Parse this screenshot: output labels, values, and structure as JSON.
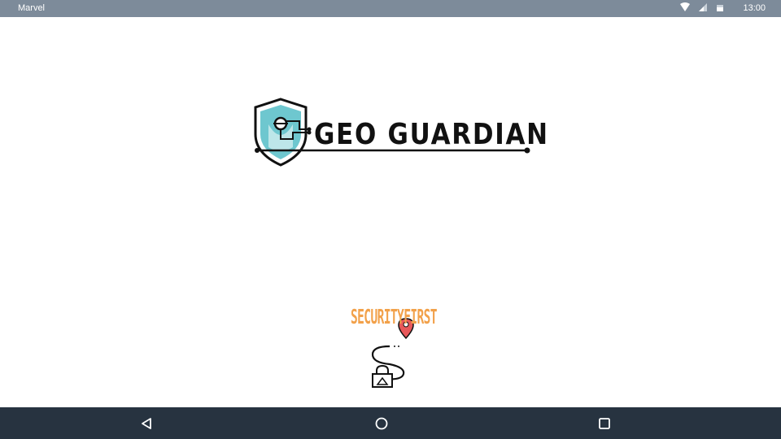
{
  "status_bar": {
    "carrier": "Marvel",
    "time": "13:00",
    "icons": [
      "wifi-icon",
      "cell-signal-icon",
      "battery-icon"
    ]
  },
  "splash": {
    "app_name": "GEO GUARDIAN",
    "partner_name": "SECURITYFIRST",
    "colors": {
      "shield_fill": "#6ec7cf",
      "logo_ink": "#111111",
      "partner_accent": "#f2a14a",
      "pin_red": "#e8585a"
    }
  },
  "nav_bar": {
    "buttons": [
      "back-button",
      "home-button",
      "recents-button"
    ]
  }
}
